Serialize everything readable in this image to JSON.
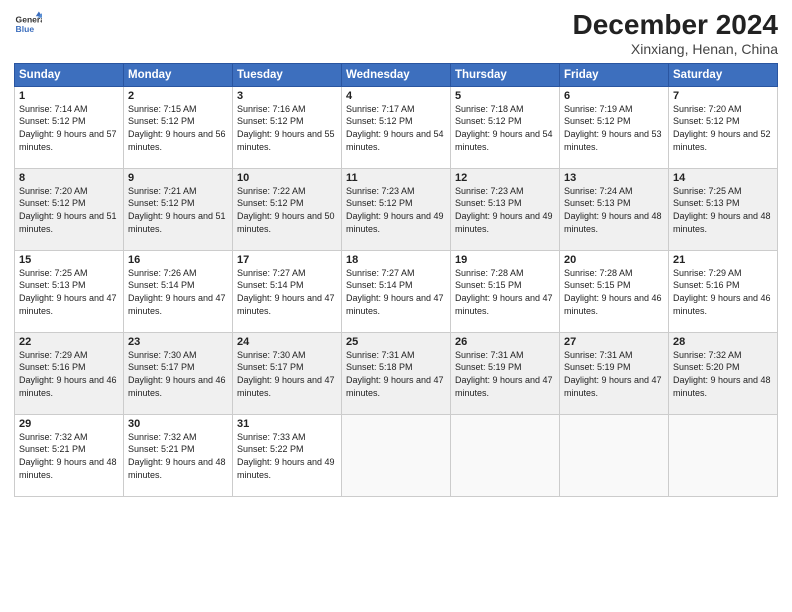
{
  "header": {
    "logo_line1": "General",
    "logo_line2": "Blue",
    "month": "December 2024",
    "location": "Xinxiang, Henan, China"
  },
  "weekdays": [
    "Sunday",
    "Monday",
    "Tuesday",
    "Wednesday",
    "Thursday",
    "Friday",
    "Saturday"
  ],
  "weeks": [
    [
      {
        "day": "1",
        "sunrise": "7:14 AM",
        "sunset": "5:12 PM",
        "daylight": "9 hours and 57 minutes."
      },
      {
        "day": "2",
        "sunrise": "7:15 AM",
        "sunset": "5:12 PM",
        "daylight": "9 hours and 56 minutes."
      },
      {
        "day": "3",
        "sunrise": "7:16 AM",
        "sunset": "5:12 PM",
        "daylight": "9 hours and 55 minutes."
      },
      {
        "day": "4",
        "sunrise": "7:17 AM",
        "sunset": "5:12 PM",
        "daylight": "9 hours and 54 minutes."
      },
      {
        "day": "5",
        "sunrise": "7:18 AM",
        "sunset": "5:12 PM",
        "daylight": "9 hours and 54 minutes."
      },
      {
        "day": "6",
        "sunrise": "7:19 AM",
        "sunset": "5:12 PM",
        "daylight": "9 hours and 53 minutes."
      },
      {
        "day": "7",
        "sunrise": "7:20 AM",
        "sunset": "5:12 PM",
        "daylight": "9 hours and 52 minutes."
      }
    ],
    [
      {
        "day": "8",
        "sunrise": "7:20 AM",
        "sunset": "5:12 PM",
        "daylight": "9 hours and 51 minutes."
      },
      {
        "day": "9",
        "sunrise": "7:21 AM",
        "sunset": "5:12 PM",
        "daylight": "9 hours and 51 minutes."
      },
      {
        "day": "10",
        "sunrise": "7:22 AM",
        "sunset": "5:12 PM",
        "daylight": "9 hours and 50 minutes."
      },
      {
        "day": "11",
        "sunrise": "7:23 AM",
        "sunset": "5:12 PM",
        "daylight": "9 hours and 49 minutes."
      },
      {
        "day": "12",
        "sunrise": "7:23 AM",
        "sunset": "5:13 PM",
        "daylight": "9 hours and 49 minutes."
      },
      {
        "day": "13",
        "sunrise": "7:24 AM",
        "sunset": "5:13 PM",
        "daylight": "9 hours and 48 minutes."
      },
      {
        "day": "14",
        "sunrise": "7:25 AM",
        "sunset": "5:13 PM",
        "daylight": "9 hours and 48 minutes."
      }
    ],
    [
      {
        "day": "15",
        "sunrise": "7:25 AM",
        "sunset": "5:13 PM",
        "daylight": "9 hours and 47 minutes."
      },
      {
        "day": "16",
        "sunrise": "7:26 AM",
        "sunset": "5:14 PM",
        "daylight": "9 hours and 47 minutes."
      },
      {
        "day": "17",
        "sunrise": "7:27 AM",
        "sunset": "5:14 PM",
        "daylight": "9 hours and 47 minutes."
      },
      {
        "day": "18",
        "sunrise": "7:27 AM",
        "sunset": "5:14 PM",
        "daylight": "9 hours and 47 minutes."
      },
      {
        "day": "19",
        "sunrise": "7:28 AM",
        "sunset": "5:15 PM",
        "daylight": "9 hours and 47 minutes."
      },
      {
        "day": "20",
        "sunrise": "7:28 AM",
        "sunset": "5:15 PM",
        "daylight": "9 hours and 46 minutes."
      },
      {
        "day": "21",
        "sunrise": "7:29 AM",
        "sunset": "5:16 PM",
        "daylight": "9 hours and 46 minutes."
      }
    ],
    [
      {
        "day": "22",
        "sunrise": "7:29 AM",
        "sunset": "5:16 PM",
        "daylight": "9 hours and 46 minutes."
      },
      {
        "day": "23",
        "sunrise": "7:30 AM",
        "sunset": "5:17 PM",
        "daylight": "9 hours and 46 minutes."
      },
      {
        "day": "24",
        "sunrise": "7:30 AM",
        "sunset": "5:17 PM",
        "daylight": "9 hours and 47 minutes."
      },
      {
        "day": "25",
        "sunrise": "7:31 AM",
        "sunset": "5:18 PM",
        "daylight": "9 hours and 47 minutes."
      },
      {
        "day": "26",
        "sunrise": "7:31 AM",
        "sunset": "5:19 PM",
        "daylight": "9 hours and 47 minutes."
      },
      {
        "day": "27",
        "sunrise": "7:31 AM",
        "sunset": "5:19 PM",
        "daylight": "9 hours and 47 minutes."
      },
      {
        "day": "28",
        "sunrise": "7:32 AM",
        "sunset": "5:20 PM",
        "daylight": "9 hours and 48 minutes."
      }
    ],
    [
      {
        "day": "29",
        "sunrise": "7:32 AM",
        "sunset": "5:21 PM",
        "daylight": "9 hours and 48 minutes."
      },
      {
        "day": "30",
        "sunrise": "7:32 AM",
        "sunset": "5:21 PM",
        "daylight": "9 hours and 48 minutes."
      },
      {
        "day": "31",
        "sunrise": "7:33 AM",
        "sunset": "5:22 PM",
        "daylight": "9 hours and 49 minutes."
      },
      null,
      null,
      null,
      null
    ]
  ]
}
